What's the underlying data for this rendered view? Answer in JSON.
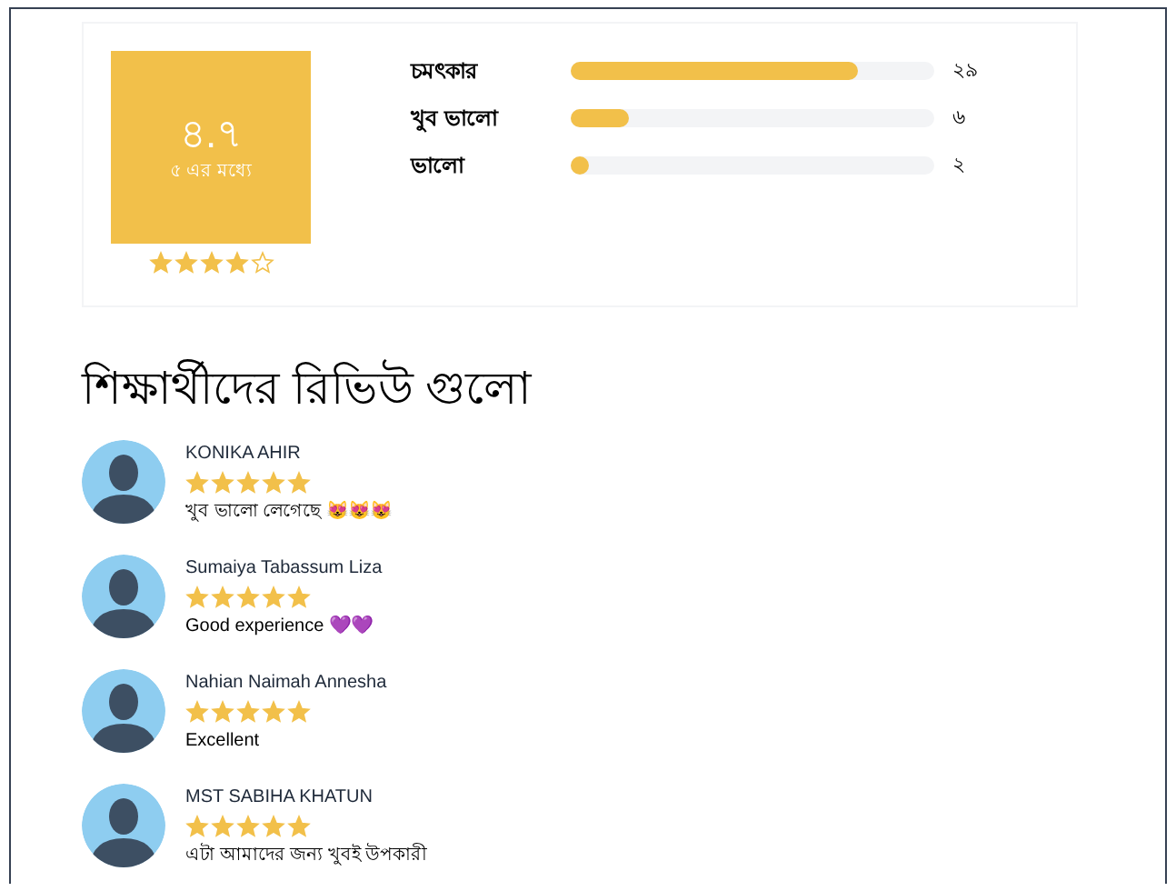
{
  "summary": {
    "rating": "৪.৭",
    "rating_caption": "৫ এর মধ্যে",
    "stars": 4
  },
  "breakdown": [
    {
      "label": "চমৎকার",
      "level": 0.79,
      "count": "২৯"
    },
    {
      "label": "খুব ভালো",
      "level": 0.16,
      "count": "৬"
    },
    {
      "label": "ভালো",
      "level": 0.05,
      "count": "২"
    }
  ],
  "heading": "শিক্ষার্থীদের রিভিউ গুলো",
  "reviews": [
    {
      "name": "KONIKA AHIR",
      "stars": 5,
      "comment": "খুব ভালো লেগেছে 😻😻😻"
    },
    {
      "name": "Sumaiya Tabassum Liza",
      "stars": 5,
      "comment": "Good experience 💜💜"
    },
    {
      "name": "Nahian Naimah Annesha",
      "stars": 5,
      "comment": "Excellent"
    },
    {
      "name": "MST SABIHA KHATUN",
      "stars": 5,
      "comment": "এটা আমাদের জন্য খুবই উপকারী"
    }
  ]
}
